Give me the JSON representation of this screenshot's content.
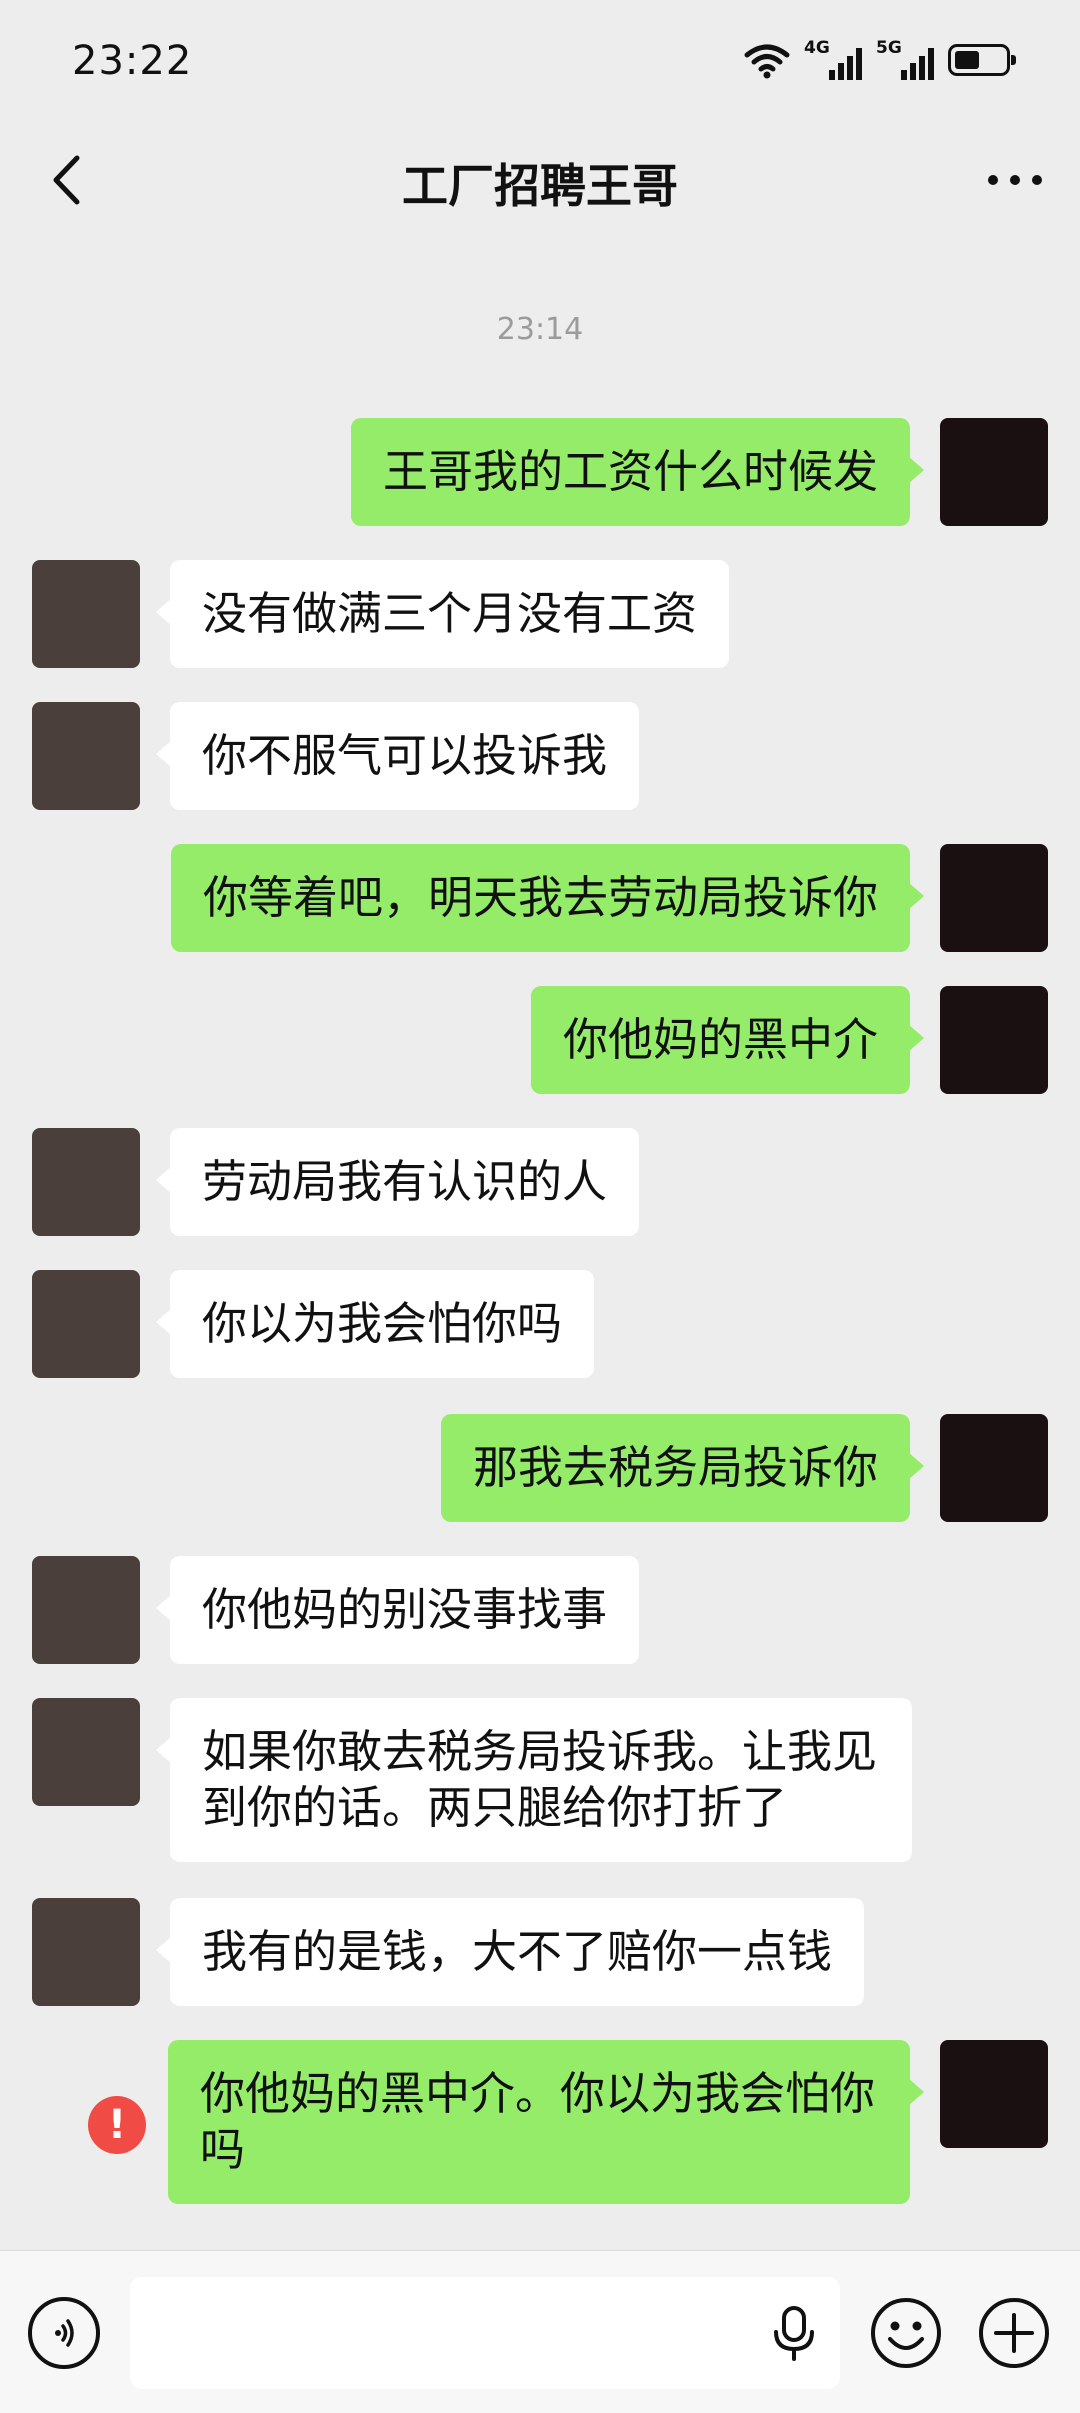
{
  "status": {
    "time": "23:22",
    "net1": "4G",
    "net2": "5G"
  },
  "nav": {
    "title": "工厂招聘王哥"
  },
  "chat": {
    "timestamp": "23:14",
    "messages": [
      {
        "side": "me",
        "text": "王哥我的工资什么时候发"
      },
      {
        "side": "them",
        "text": "没有做满三个月没有工资"
      },
      {
        "side": "them",
        "text": "你不服气可以投诉我"
      },
      {
        "side": "me",
        "text": "你等着吧，明天我去劳动局投诉你"
      },
      {
        "side": "me",
        "text": "你他妈的黑中介"
      },
      {
        "side": "them",
        "text": "劳动局我有认识的人"
      },
      {
        "side": "them",
        "text": "你以为我会怕你吗"
      },
      {
        "side": "me",
        "text": "那我去税务局投诉你"
      },
      {
        "side": "them",
        "text": "你他妈的别没事找事"
      },
      {
        "side": "them",
        "text": "如果你敢去税务局投诉我。让我见到你的话。两只腿给你打折了"
      },
      {
        "side": "them",
        "text": "我有的是钱，大不了赔你一点钱"
      },
      {
        "side": "me",
        "text": "你他妈的黑中介。你以为我会怕你吗",
        "status": "failed"
      }
    ],
    "error_mark": "!"
  },
  "input": {
    "value": "",
    "placeholder": ""
  },
  "colors": {
    "background": "#ededed",
    "my_bubble": "#95ec69",
    "their_bubble": "#ffffff",
    "error": "#f04c45"
  }
}
